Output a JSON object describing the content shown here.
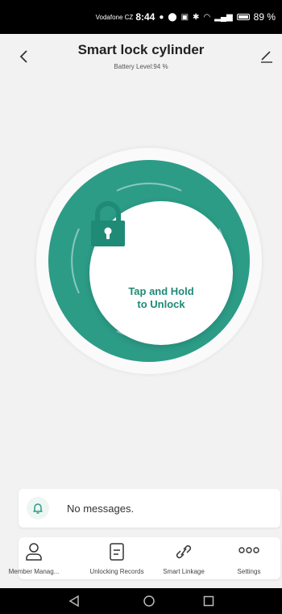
{
  "status_bar": {
    "carrier": "Vodafone CZ",
    "time": "8:44",
    "battery_percent": "89 %"
  },
  "header": {
    "title": "Smart lock cylinder",
    "battery_level": "Battery Level:94 %"
  },
  "lock": {
    "action_line1": "Tap and Hold",
    "action_line2": "to Unlock"
  },
  "messages": {
    "text": "No messages."
  },
  "bottom_nav": {
    "items": [
      {
        "label": "Member Manag...",
        "icon": "person-icon"
      },
      {
        "label": "Unlocking Records",
        "icon": "records-icon"
      },
      {
        "label": "Smart Linkage",
        "icon": "link-icon"
      },
      {
        "label": "Settings",
        "icon": "more-icon"
      }
    ]
  },
  "colors": {
    "accent": "#2c9c87",
    "accent_dark": "#1f8a76",
    "background": "#f2f2f2"
  }
}
